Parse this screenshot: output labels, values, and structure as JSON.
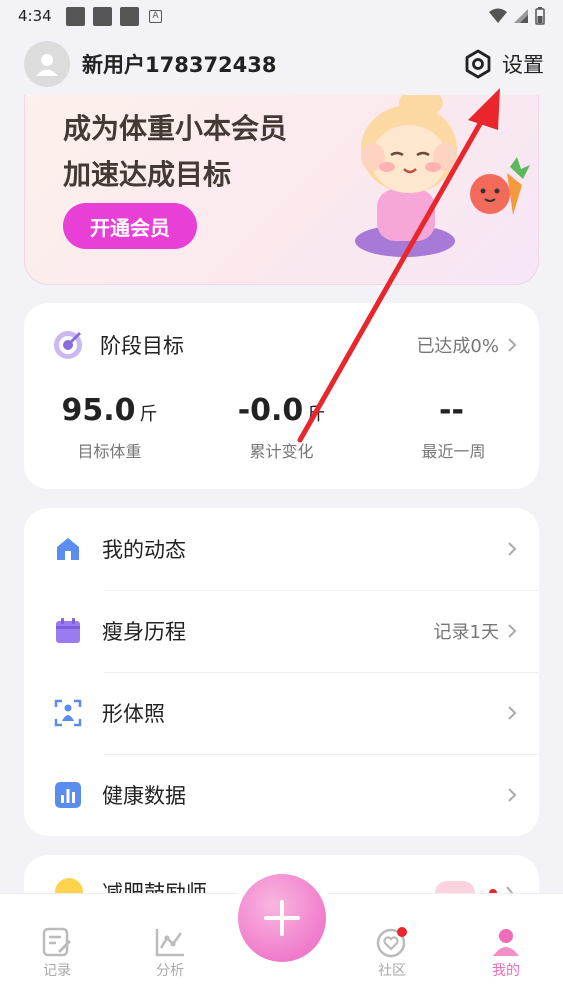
{
  "status_bar": {
    "time": "4:34"
  },
  "header": {
    "username": "新用户178372438",
    "settings_label": "设置"
  },
  "banner": {
    "line1": "成为体重小本会员",
    "line2": "加速达成目标",
    "button": "开通会员"
  },
  "goal": {
    "title": "阶段目标",
    "progress": "已达成0%",
    "stats": [
      {
        "value": "95.0",
        "unit": "斤",
        "label": "目标体重"
      },
      {
        "value": "-0.0",
        "unit": "斤",
        "label": "累计变化"
      },
      {
        "value": "--",
        "unit": "",
        "label": "最近一周"
      }
    ]
  },
  "menu": {
    "items": [
      {
        "label": "我的动态",
        "extra": "",
        "icon": "home-icon"
      },
      {
        "label": "瘦身历程",
        "extra": "记录1天",
        "icon": "calendar-icon"
      },
      {
        "label": "形体照",
        "extra": "",
        "icon": "body-scan-icon"
      },
      {
        "label": "健康数据",
        "extra": "",
        "icon": "chart-icon"
      }
    ]
  },
  "card3": {
    "label": "减肥鼓励师"
  },
  "tabbar": {
    "tabs": [
      {
        "label": "记录",
        "icon": "record-icon"
      },
      {
        "label": "分析",
        "icon": "analysis-icon"
      },
      {
        "label": "社区",
        "icon": "community-icon"
      },
      {
        "label": "我的",
        "icon": "profile-icon"
      }
    ]
  },
  "colors": {
    "accent": "#e83fd6",
    "tab_active": "#f06bb8",
    "menu_icon": "#5b8def",
    "arrow": "#e8262b"
  }
}
